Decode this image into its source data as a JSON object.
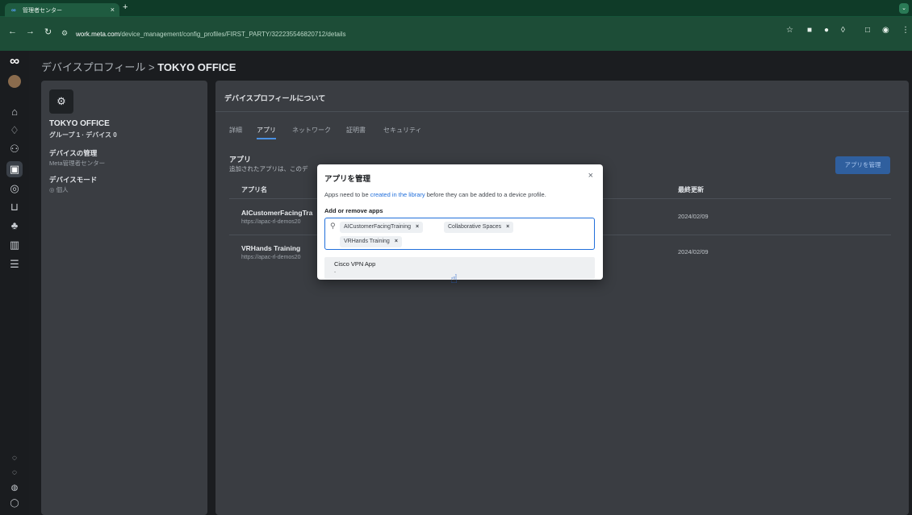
{
  "browser": {
    "tab_title": "管理者センター",
    "tab_favicon": "∞",
    "close": "×",
    "newtab": "+",
    "tab_menu": "⌄",
    "url_host": "work.meta.com",
    "url_path": "/device_management/config_profiles/FIRST_PARTY/322235546820712/details"
  },
  "nav": {
    "items": [
      "home-icon",
      "bell-icon",
      "people-icon",
      "device-icon",
      "shield-icon",
      "cart-icon",
      "groups-icon",
      "analytics-icon",
      "settings-list-icon"
    ],
    "bottom": [
      "lock-icon",
      "bug-icon",
      "globe-icon",
      "help-icon"
    ]
  },
  "breadcrumb": {
    "parent": "デバイスプロフィール",
    "separator": ">",
    "current": "TOKYO OFFICE"
  },
  "profile": {
    "name": "TOKYO OFFICE",
    "meta": "グループ 1 · デバイス 0",
    "manage_label": "デバイスの管理",
    "manage_value": "Meta管理者センター",
    "mode_label": "デバイスモード",
    "mode_value": "個人"
  },
  "main": {
    "title": "デバイスプロフィールについて",
    "tabs": [
      "詳細",
      "アプリ",
      "ネットワーク",
      "証明書",
      "セキュリティ"
    ],
    "active_tab": "アプリ",
    "section_title": "アプリ",
    "section_desc": "追加されたアプリは、このデ",
    "manage_button": "アプリを管理",
    "col_name": "アプリ名",
    "col_updated": "最終更新",
    "rows": [
      {
        "name": "AICustomerFacingTra",
        "url": "https://apac-rl-demos20",
        "updated": "2024/02/09"
      },
      {
        "name": "VRHands Training",
        "url": "https://apac-rl-demos20",
        "updated": "2024/02/09"
      }
    ]
  },
  "modal": {
    "title": "アプリを管理",
    "close": "×",
    "desc_before": "Apps need to be ",
    "desc_link": "created in the library",
    "desc_after": " before they can be added to a device profile.",
    "label": "Add or remove apps",
    "chips": [
      "AICustomerFacingTraining",
      "Collaborative Spaces",
      "VRHands Training"
    ],
    "chip_remove": "×",
    "suggestion_name": "Cisco VPN App",
    "suggestion_sub": "-"
  },
  "colors": {
    "accent": "#216fdb",
    "chrome": "#1d4d37",
    "panel": "#3a3d42"
  }
}
